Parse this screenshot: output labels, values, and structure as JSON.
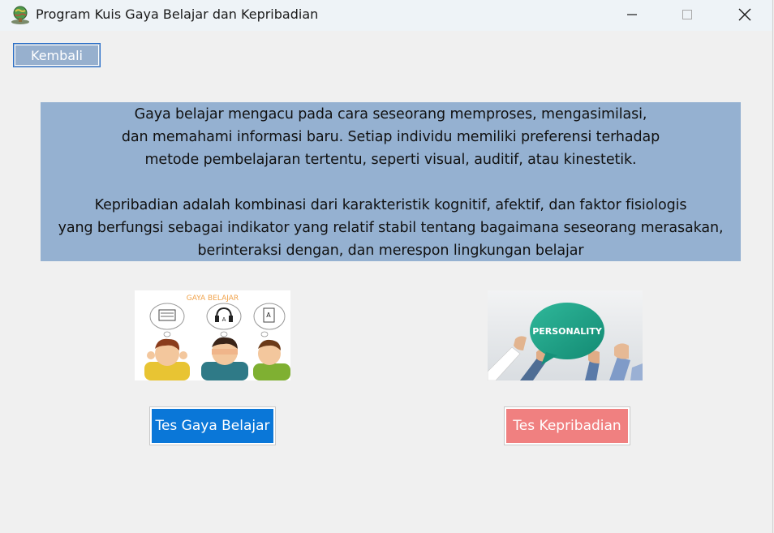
{
  "window": {
    "title": "Program Kuis Gaya Belajar dan Kepribadian",
    "icon": "app-globe-icon",
    "controls": [
      "minimize-icon",
      "maximize-icon",
      "close-icon"
    ]
  },
  "toolbar": {
    "back_label": "Kembali"
  },
  "info": {
    "lines": [
      "Gaya belajar mengacu pada cara seseorang memproses, mengasimilasi,",
      "dan memahami informasi baru. Setiap individu memiliki preferensi terhadap",
      "metode pembelajaran tertentu, seperti visual, auditif, atau kinestetik.",
      "",
      "Kepribadian adalah kombinasi dari karakteristik kognitif, afektif, dan faktor fisiologis",
      "yang berfungsi sebagai indikator yang relatif stabil tentang bagaimana seseorang merasakan,",
      "berinteraksi dengan, dan merespon lingkungan belajar"
    ]
  },
  "images": {
    "gaya_caption": "GAYA BELAJAR",
    "personality_caption": "PERSONALITY"
  },
  "buttons": {
    "gaya_label": "Tes Gaya Belajar",
    "kepribadian_label": "Tes Kepribadian"
  },
  "colors": {
    "info_panel": "#95b1d1",
    "back_button": "#97b0ce",
    "gaya_button": "#0a77d8",
    "kepribadian_button": "#f08080",
    "window_bg": "#f0f0f0"
  }
}
